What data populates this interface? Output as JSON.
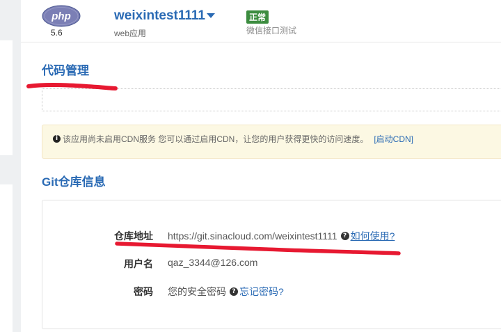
{
  "app": {
    "logo_text": "php",
    "version": "5.6",
    "name": "weixintest1111",
    "type": "web应用",
    "status": "正常",
    "description": "微信接口测试"
  },
  "sections": {
    "code_management": "代码管理",
    "git_info": "Git仓库信息"
  },
  "notice": {
    "text": "该应用尚未启用CDN服务 您可以通过启用CDN，让您的用户获得更快的访问速度。",
    "link": "[启动CDN]"
  },
  "git": {
    "repo_label": "仓库地址",
    "repo_url": "https://git.sinacloud.com/weixintest1111",
    "how_to_use": "如何使用?",
    "username_label": "用户名",
    "username": "qaz_3344@126.com",
    "password_label": "密码",
    "password_value": "您的安全密码",
    "forgot_password": "忘记密码?"
  },
  "colors": {
    "brand_blue": "#2a6ab4",
    "status_green": "#3c8c3f",
    "notice_bg": "#fcf8e3",
    "scribble_red": "#e4001b"
  },
  "icons": {
    "logo": "php-logo-icon",
    "dropdown": "chevron-down-icon",
    "info": "info-circle-icon",
    "help": "question-circle-icon"
  }
}
